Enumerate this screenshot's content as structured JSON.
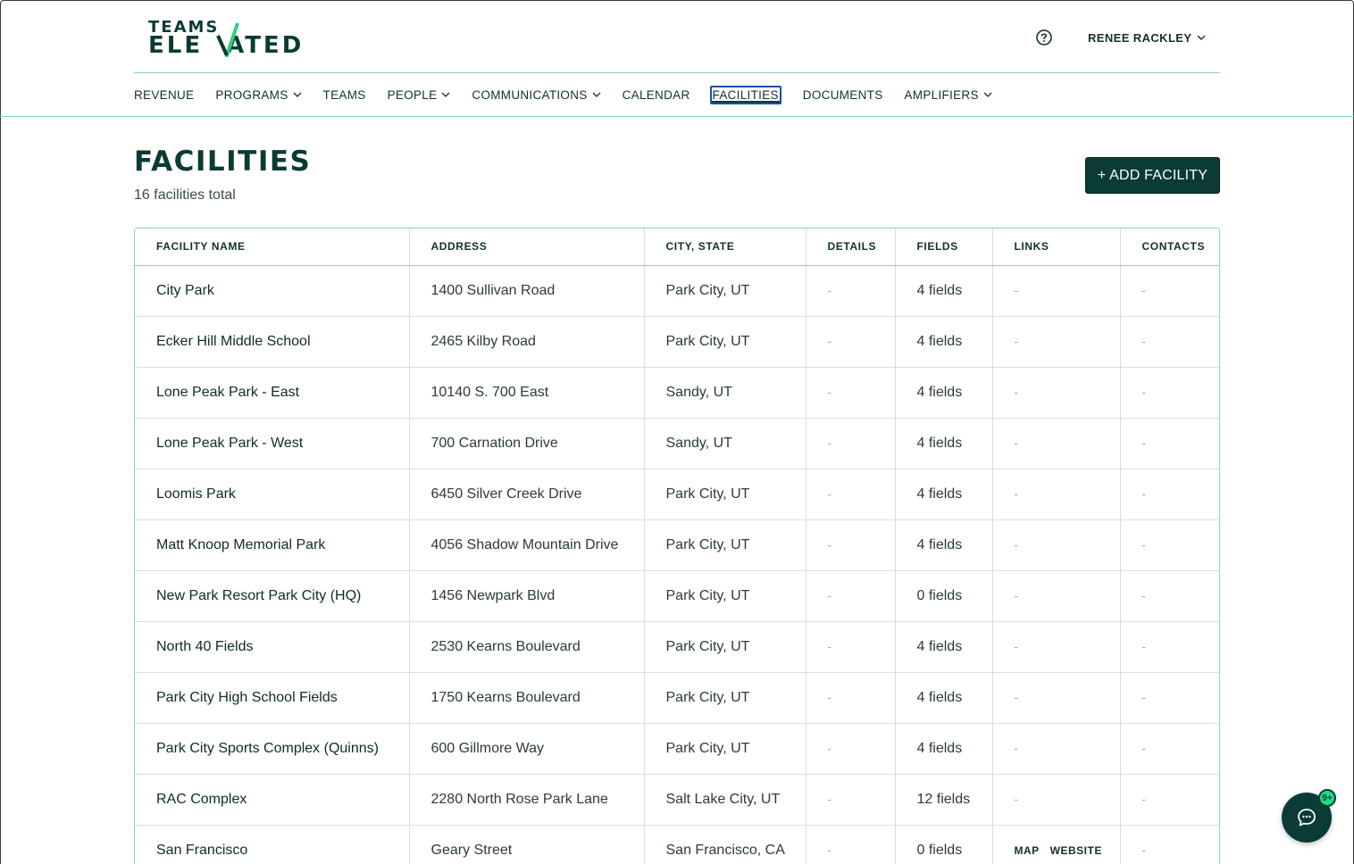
{
  "brand": {
    "logo_top": "TEAMS",
    "logo_bottom_left": "ELE",
    "logo_bottom_right": "ATED",
    "accent": "#0b3b35",
    "teal_line": "#7fd3c9",
    "check_green": "#2fd17a"
  },
  "header": {
    "user_name": "RENEE RACKLEY",
    "help_icon": "question-circle-icon"
  },
  "nav": [
    {
      "label": "REVENUE",
      "has_menu": false,
      "active": false
    },
    {
      "label": "PROGRAMS",
      "has_menu": true,
      "active": false
    },
    {
      "label": "TEAMS",
      "has_menu": false,
      "active": false
    },
    {
      "label": "PEOPLE",
      "has_menu": true,
      "active": false
    },
    {
      "label": "COMMUNICATIONS",
      "has_menu": true,
      "active": false
    },
    {
      "label": "CALENDAR",
      "has_menu": false,
      "active": false
    },
    {
      "label": "FACILITIES",
      "has_menu": false,
      "active": true
    },
    {
      "label": "DOCUMENTS",
      "has_menu": false,
      "active": false
    },
    {
      "label": "AMPLIFIERS",
      "has_menu": true,
      "active": false
    }
  ],
  "page": {
    "title": "FACILITIES",
    "subtitle": "16 facilities total",
    "add_button": "+ ADD FACILITY"
  },
  "table": {
    "columns": [
      "FACILITY NAME",
      "ADDRESS",
      "CITY, STATE",
      "DETAILS",
      "FIELDS",
      "LINKS",
      "CONTACTS"
    ],
    "rows": [
      {
        "name": "City Park",
        "address": "1400 Sullivan Road",
        "city": "Park City, UT",
        "details": "-",
        "fields": "4 fields",
        "links": [
          "-"
        ],
        "contacts": "-"
      },
      {
        "name": "Ecker Hill Middle School",
        "address": "2465 Kilby Road",
        "city": "Park City, UT",
        "details": "-",
        "fields": "4 fields",
        "links": [
          "-"
        ],
        "contacts": "-"
      },
      {
        "name": "Lone Peak Park - East",
        "address": "10140 S. 700 East",
        "city": "Sandy, UT",
        "details": "-",
        "fields": "4 fields",
        "links": [
          "-"
        ],
        "contacts": "-"
      },
      {
        "name": "Lone Peak Park - West",
        "address": "700 Carnation Drive",
        "city": "Sandy, UT",
        "details": "-",
        "fields": "4 fields",
        "links": [
          "-"
        ],
        "contacts": "-"
      },
      {
        "name": "Loomis Park",
        "address": "6450 Silver Creek Drive",
        "city": "Park City, UT",
        "details": "-",
        "fields": "4 fields",
        "links": [
          "-"
        ],
        "contacts": "-"
      },
      {
        "name": "Matt Knoop Memorial Park",
        "address": "4056 Shadow Mountain Drive",
        "city": "Park City, UT",
        "details": "-",
        "fields": "4 fields",
        "links": [
          "-"
        ],
        "contacts": "-"
      },
      {
        "name": "New Park Resort Park City (HQ)",
        "address": "1456 Newpark Blvd",
        "city": "Park City, UT",
        "details": "-",
        "fields": "0 fields",
        "links": [
          "-"
        ],
        "contacts": "-"
      },
      {
        "name": "North 40 Fields",
        "address": "2530 Kearns Boulevard",
        "city": "Park City, UT",
        "details": "-",
        "fields": "4 fields",
        "links": [
          "-"
        ],
        "contacts": "-"
      },
      {
        "name": "Park City High School Fields",
        "address": "1750 Kearns Boulevard",
        "city": "Park City, UT",
        "details": "-",
        "fields": "4 fields",
        "links": [
          "-"
        ],
        "contacts": "-"
      },
      {
        "name": "Park City Sports Complex (Quinns)",
        "address": "600 Gillmore Way",
        "city": "Park City, UT",
        "details": "-",
        "fields": "4 fields",
        "links": [
          "-"
        ],
        "contacts": "-"
      },
      {
        "name": "RAC Complex",
        "address": "2280 North Rose Park Lane",
        "city": "Salt Lake City, UT",
        "details": "-",
        "fields": "12 fields",
        "links": [
          "-"
        ],
        "contacts": "-"
      },
      {
        "name": "San Francisco",
        "address": "Geary Street",
        "city": "San Francisco, CA",
        "details": "-",
        "fields": "0 fields",
        "links": [
          "MAP",
          "WEBSITE"
        ],
        "contacts": "-"
      }
    ]
  },
  "chat": {
    "icon": "chat-bubble-icon",
    "badge": "9+"
  }
}
